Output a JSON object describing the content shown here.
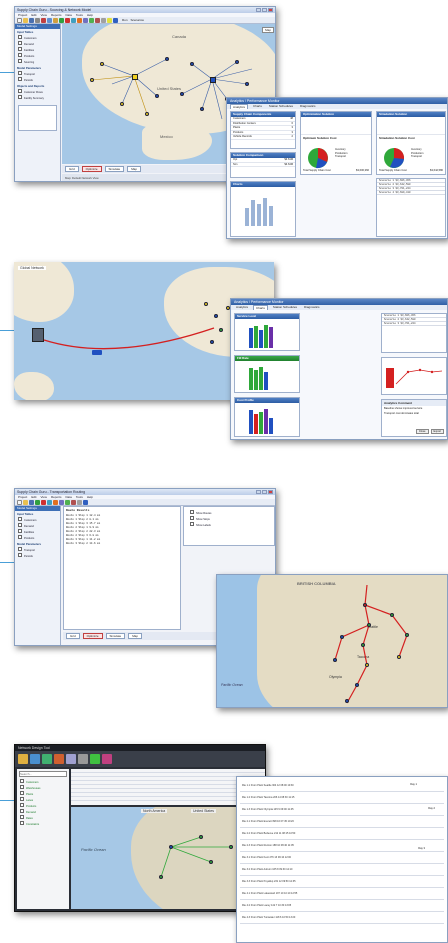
{
  "screen1": {
    "window_title": "Supply Chain Guru - Sourcing & Network Model",
    "menu": [
      "Project",
      "Edit",
      "View",
      "Reports",
      "Data",
      "Tools",
      "Help"
    ],
    "toolbar_buttons": [
      "Run",
      "Scenarios",
      "Map",
      "Tables"
    ],
    "side_panel": {
      "header": "Model Settings",
      "section_inputs": "Input Tables",
      "items_top": [
        "Customers",
        "Demand",
        "Facilities",
        "Products",
        "Sourcing"
      ],
      "section_model": "Model Parameters",
      "items_mid": [
        "Transport",
        "Periods"
      ],
      "section_objects": "Objects and Reports",
      "items_bottom": [
        "Customer Flows",
        "Facility Summary"
      ]
    },
    "map_labels": [
      "Canada",
      "United States",
      "Mexico"
    ],
    "map_zoom_label": "Map",
    "bottom_tabs": [
      "Grid",
      "Optimize",
      "Simulate",
      "Map"
    ],
    "status_text": "Map: Default Network View"
  },
  "analytics_window": {
    "title": "Analytics / Performance Monitor",
    "tabs": [
      "Analytics",
      "Charts",
      "Station Schedules",
      "Diagnostics"
    ],
    "panel_components": {
      "title": "Supply Chain Components",
      "rows": [
        {
          "k": "Customers",
          "v": "48"
        },
        {
          "k": "Distribution Centers",
          "v": "6"
        },
        {
          "k": "Plants",
          "v": "3"
        },
        {
          "k": "Products",
          "v": "3"
        },
        {
          "k": "Vehicle Records",
          "v": "2"
        }
      ]
    },
    "panel_opt": {
      "title": "Optimization Solution",
      "cost_title": "Optimum Solution Cost",
      "total_label": "Total Supply Chain Cost",
      "total_value": "$3,606,366",
      "legend": [
        "Inventory",
        "Production",
        "Transport"
      ]
    },
    "panel_sim": {
      "title": "Simulation Solution",
      "cost_title": "Simulation Solution Cost",
      "total_label": "Total Supply Chain Cost",
      "total_value": "$3,642,580",
      "legend": [
        "Inventory",
        "Production",
        "Transport"
      ]
    },
    "panel_compare": {
      "title": "Solution Comparison",
      "rows": [
        {
          "k": "Opt",
          "v": "$3.61M"
        },
        {
          "k": "Sim",
          "v": "$3.64M"
        }
      ]
    },
    "panel_chart_title": "Charts",
    "panel_table_lines": [
      "Scenario 1   $3,606,366",
      "Scenario 2   $3,642,580",
      "Scenario 3   $3,701,224",
      "Scenario 4   $3,689,410"
    ]
  },
  "screen2": {
    "map_label": "Global Network",
    "analytics_title": "Analytics / Performance Monitor",
    "tabs": [
      "Analytics",
      "Charts",
      "Station Schedules",
      "Diagnostics"
    ],
    "chart_titles": [
      "Service Level",
      "Fill Rate",
      "Cost Profile"
    ],
    "table_lines": [
      "Scenario 1   $3,606,366",
      "Scenario 2   $3,642,580",
      "Scenario 3   $3,701,224"
    ],
    "messages_title": "Analytics Comment",
    "messages": [
      "Baseline shows improved service",
      "Transport cost dominates total"
    ],
    "buttons": [
      "Close",
      "Export"
    ]
  },
  "screen3": {
    "window_title": "Supply Chain Guru - Transportation Routing",
    "menu": [
      "Project",
      "Edit",
      "View",
      "Reports",
      "Data",
      "Tools",
      "Help"
    ],
    "results_header": "Route Results",
    "results_lines": [
      "Route 1   Stop 1   12.4 mi",
      "Route 1   Stop 2   8.1 mi",
      "Route 1   Stop 3   15.7 mi",
      "Route 2   Stop 1   9.9 mi",
      "Route 2   Stop 2   22.3 mi",
      "Route 2   Stop 3   6.8 mi",
      "Route 3   Stop 1   11.2 mi",
      "Route 3   Stop 2   14.6 mi"
    ],
    "route_options": [
      "Show Routes",
      "Show Stops",
      "Show Labels"
    ],
    "bottom_tabs": [
      "Grid",
      "Optimize",
      "Simulate",
      "Map"
    ],
    "map_labels": [
      "BRITISH COLUMBIA",
      "Seattle",
      "Tacoma",
      "Olympia",
      "Pacific Ocean"
    ]
  },
  "screen4": {
    "window_title": "Network Design Tool",
    "filter_placeholder": "Search...",
    "side_items": [
      "Customers",
      "Warehouses",
      "Plants",
      "Lanes",
      "Products",
      "Demand",
      "Rates",
      "Constraints"
    ],
    "map_labels": [
      "Pacific Ocean",
      "North America",
      "United States"
    ],
    "table_rows": [
      "Rte 1.1  From Plant  Seattle  304  12  08:00  10:30",
      "Rte 1.2  From Plant  Tacoma  206  14  08:30  11:15",
      "Rte 1.3  From Plant  Olympia  145  9  09:00  11:45",
      "Rte 2.1  From Plant  Everett  398  16  07:45  10:20",
      "Rte 2.2  From Plant  Bellevue  212  11  08:15  10:50",
      "Rte 2.3  From Plant  Renton  188  10  08:40  11:05",
      "Rte 3.1  From Plant  Kent  276  13  09:10  12:00",
      "Rte 3.2  From Plant  Auburn  165  8  09:30  12:10",
      "Rte 3.3  From Plant  Puyallup  231  12  09:50  12:35",
      "Rte 4.1  From Plant  Lakewood  197  10  10:10  12:55",
      "Rte 4.2  From Plant  Lacey  142  7  10:30  13:05",
      "Rte 4.3  From Plant  Tumwater  118  6  10:50  13:20"
    ],
    "day_labels": [
      "Day 1",
      "Day 2",
      "Day 3"
    ]
  },
  "colors": {
    "accent": "#3d6fb6",
    "connector": "#4a9fd8",
    "route_red": "#d42020",
    "node_green": "#2fa83a",
    "node_yellow": "#f0d020",
    "node_blue": "#2050c0"
  }
}
